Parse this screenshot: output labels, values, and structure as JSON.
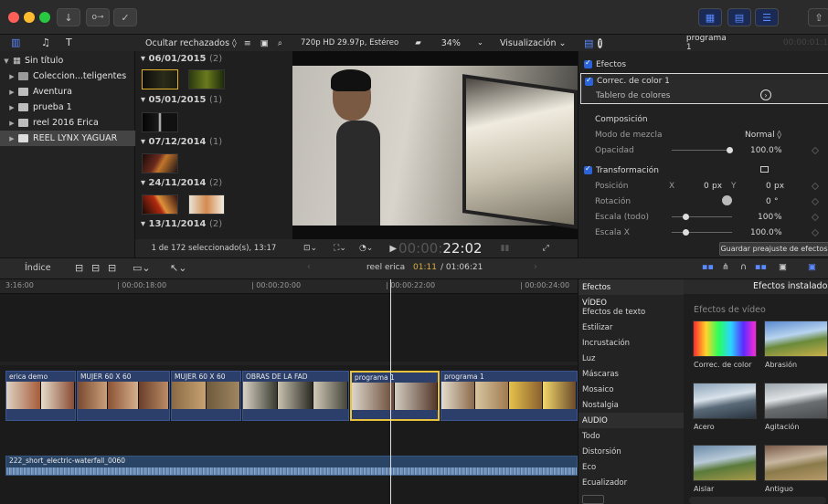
{
  "titlebar": {
    "traffic_colors": [
      "#ff5f57",
      "#febc2e",
      "#28c840"
    ],
    "download_icon": "download-icon",
    "key_icon": "key-icon",
    "check_icon": "checkmark-icon"
  },
  "library": {
    "items": [
      {
        "label": "Sin título",
        "expanded": true,
        "level": 0,
        "icon": "library-icon"
      },
      {
        "label": "Coleccion...teligentes",
        "level": 1,
        "icon": "folder-icon"
      },
      {
        "label": "Aventura",
        "level": 1,
        "icon": "event-icon"
      },
      {
        "label": "prueba 1",
        "level": 1,
        "icon": "event-icon"
      },
      {
        "label": "reel 2016 Erica",
        "level": 1,
        "icon": "event-icon"
      },
      {
        "label": "REEL LYNX YAGUAR",
        "level": 1,
        "icon": "event-icon",
        "selected": true
      }
    ]
  },
  "browser": {
    "filter_label": "Ocultar rechazados ◊",
    "groups": [
      {
        "date": "06/01/2015",
        "count": "(2)"
      },
      {
        "date": "05/01/2015",
        "count": "(1)"
      },
      {
        "date": "07/12/2014",
        "count": "(1)"
      },
      {
        "date": "24/11/2014",
        "count": "(2)"
      },
      {
        "date": "13/11/2014",
        "count": "(2)"
      }
    ],
    "status": "1 de 172 seleccionado(s), 13:17"
  },
  "viewer": {
    "format": "720p HD 29.97p, Estéreo",
    "zoom": "34%",
    "visualization": "Visualización ⌄",
    "timecode_dim": "00:00:",
    "timecode": "22:02"
  },
  "inspector": {
    "title": "programa 1",
    "timecode": "00:00:01:1",
    "effects_label": "Efectos",
    "color_correction": "Correc. de color 1",
    "color_board": "Tablero de colores",
    "composition": "Composición",
    "blend_mode_label": "Modo de mezcla",
    "blend_mode_value": "Normal ◊",
    "opacity_label": "Opacidad",
    "opacity_value": "100.0",
    "opacity_unit": "%",
    "transform": "Transformación",
    "position_label": "Posición",
    "position_x_label": "X",
    "position_x": "0",
    "position_x_unit": "px",
    "position_y_label": "Y",
    "position_y": "0",
    "position_y_unit": "px",
    "rotation_label": "Rotación",
    "rotation_value": "0",
    "rotation_unit": "°",
    "scale_all_label": "Escala (todo)",
    "scale_all_value": "100",
    "scale_all_unit": "%",
    "scale_x_label": "Escala X",
    "scale_x_value": "100.0",
    "scale_x_unit": "%",
    "save_preset": "Guardar preajuste de efectos"
  },
  "timeline_bar": {
    "index_label": "Índice",
    "project": "reel erica",
    "current_time": "01:11",
    "total_time": "/ 01:06:21"
  },
  "timeline": {
    "ruler": [
      "3:16:00",
      "00:00:18:00",
      "00:00:20:00",
      "00:00:22:00",
      "00:00:24:00"
    ],
    "clips": [
      {
        "name": "erica demo"
      },
      {
        "name": "MUJER 60 X 60"
      },
      {
        "name": "MUJER 60 X 60"
      },
      {
        "name": "OBRAS DE LA FAD"
      },
      {
        "name": "programa 1",
        "selected": true
      },
      {
        "name": "programa 1"
      }
    ],
    "audio_name": "222_short_electric-waterfall_0060"
  },
  "effects": {
    "header": "Efectos",
    "installed": "Efectos instalados",
    "categories": [
      {
        "label": "Efectos",
        "group": true
      },
      {
        "label": "VÍDEO",
        "group": true
      },
      {
        "label": "Efectos de texto"
      },
      {
        "label": "Estilizar"
      },
      {
        "label": "Incrustación"
      },
      {
        "label": "Luz"
      },
      {
        "label": "Máscaras"
      },
      {
        "label": "Mosaico"
      },
      {
        "label": "Nostalgia"
      },
      {
        "label": "AUDIO",
        "group": true
      },
      {
        "label": "Todo"
      },
      {
        "label": "Distorsión"
      },
      {
        "label": "Eco"
      },
      {
        "label": "Ecualizador"
      }
    ],
    "section_title": "Efectos de vídeo",
    "items": [
      {
        "name": "Correc. de color"
      },
      {
        "name": "Abrasión"
      },
      {
        "name": "Acero"
      },
      {
        "name": "Agitación"
      },
      {
        "name": "Aislar"
      },
      {
        "name": "Antiguo"
      }
    ]
  }
}
